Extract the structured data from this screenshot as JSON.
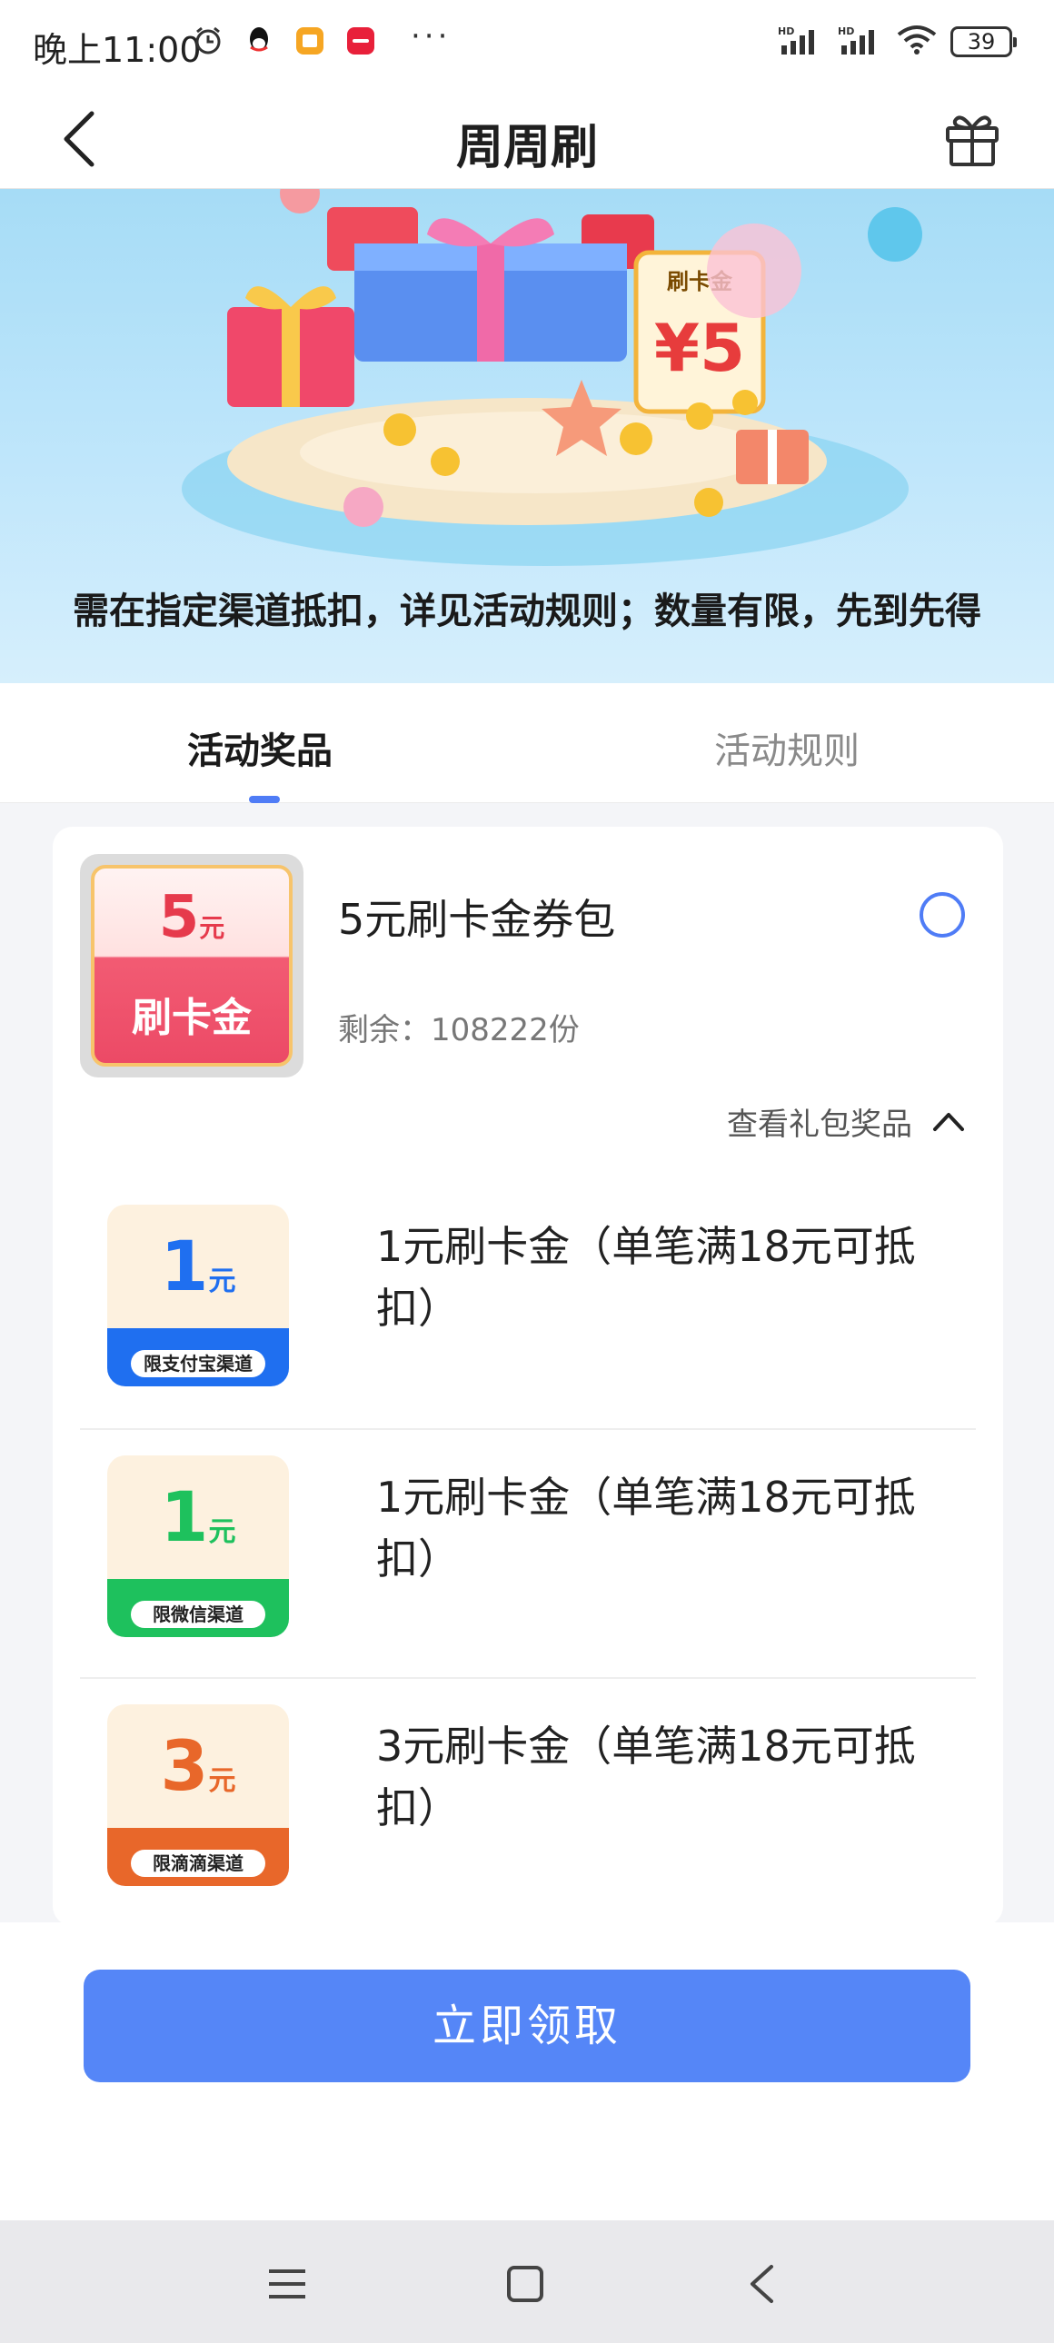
{
  "status_bar": {
    "time": "晚上11:00",
    "overflow": "···",
    "battery": "39",
    "icons": [
      "alarm-icon",
      "qq-icon",
      "note-app-icon",
      "xiaohongshu-icon",
      "signal-hd-icon",
      "signal-hd-icon",
      "wifi-icon",
      "battery-icon"
    ]
  },
  "nav": {
    "title": "周周刷",
    "back_icon": "chevron-left-icon",
    "gift_icon": "gift-icon"
  },
  "banner": {
    "notice": "需在指定渠道抵扣，详见活动规则；数量有限，先到先得"
  },
  "tabs": [
    {
      "label": "活动奖品",
      "active": true
    },
    {
      "label": "活动规则",
      "active": false
    }
  ],
  "package": {
    "thumb_amount": "5",
    "thumb_unit": "元",
    "thumb_label": "刷卡金",
    "title": "5元刷卡金券包",
    "remaining": "剩余：108222份",
    "view_gifts": "查看礼包奖品"
  },
  "gifts": [
    {
      "amount": "1",
      "unit": "元",
      "tag": "限支付宝渠道",
      "text": "1元刷卡金（单笔满18元可抵扣）",
      "color": "#1f6ff0"
    },
    {
      "amount": "1",
      "unit": "元",
      "tag": "限微信渠道",
      "text": "1元刷卡金（单笔满18元可抵扣）",
      "color": "#1ec15d"
    },
    {
      "amount": "3",
      "unit": "元",
      "tag": "限滴滴渠道",
      "text": "3元刷卡金（单笔满18元可抵扣）",
      "color": "#e8672a"
    }
  ],
  "claim_button": "立即领取",
  "system_nav": [
    "menu-icon",
    "home-square-icon",
    "back-icon"
  ],
  "colors": {
    "accent": "#5586f7",
    "tab_indicator": "#4f7cf6"
  }
}
